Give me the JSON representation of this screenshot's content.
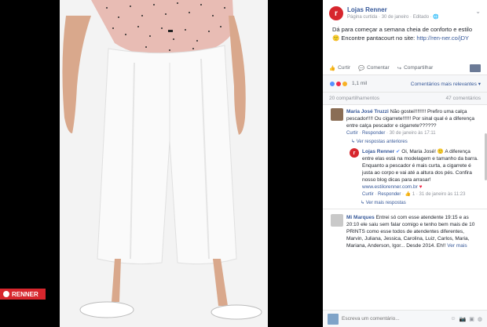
{
  "brand": {
    "tag_label": "RENNER"
  },
  "post": {
    "page_name": "Lojas Renner",
    "subtitle": "Página curtida · 30 de janeiro · Editado · ",
    "text": "Dá para começar a semana cheia de conforto e estilo 🙂 Encontre pantacourt no site: ",
    "link": "http://ren-ner.co/jDY"
  },
  "actions": {
    "like": "Curtir",
    "comment": "Comentar",
    "share": "Compartilhar"
  },
  "reactions": {
    "count": "1,1 mil",
    "sort": "Comentários mais relevantes ▾",
    "colors": [
      "#5890ff",
      "#f02849",
      "#f7b125"
    ]
  },
  "stats": {
    "shares": "20 compartilhamentos",
    "comments": "47 comentários"
  },
  "comments": [
    {
      "name": "Maria José Truzzi",
      "text": "Não gostei!!!!!!!! Prefiro uma calça pescador!!!! Ou cigarrete!!!!!! Por sinal qual é a diferença entre calça pescador e cigarrete??????",
      "like": "Curtir",
      "reply": "Responder",
      "date": "· 30 de janeiro às 17:11",
      "prev_replies": "↳ Ver respostas anteriores"
    }
  ],
  "reply": {
    "name": "Lojas Renner",
    "text": "Oi, Maria José! 🙂 A diferença entre elas está na modelagem e tamanho da barra. Enquanto a pescador é mais curta, a cigarrete é justa ao corpo e vai até a altura dos pés. Confira nosso blog dicas para arrasar!",
    "link": "www.estilorenner.com.br",
    "heart": "♥",
    "like": "Curtir",
    "reply": "Responder",
    "meta": "· 👍 1 · 31 de janeiro às 11:23",
    "more": "↳ Ver mais respostas"
  },
  "comment2": {
    "name": "Mi Marques",
    "text": "Entrei só com esse atendente 19:15 e as 20:10 ele saiu sem falar comigo e tenho bem mais de 10 PRINTS como esse todos de atendentes diferentes, Marvin, Juliana, Jessica, Carolina, Luiz, Carlos, Maria, Mariana, Anderson, Igor... Desde 2014. Eh!!",
    "more": "Ver mais"
  },
  "input": {
    "placeholder": "Escreva um comentário..."
  }
}
